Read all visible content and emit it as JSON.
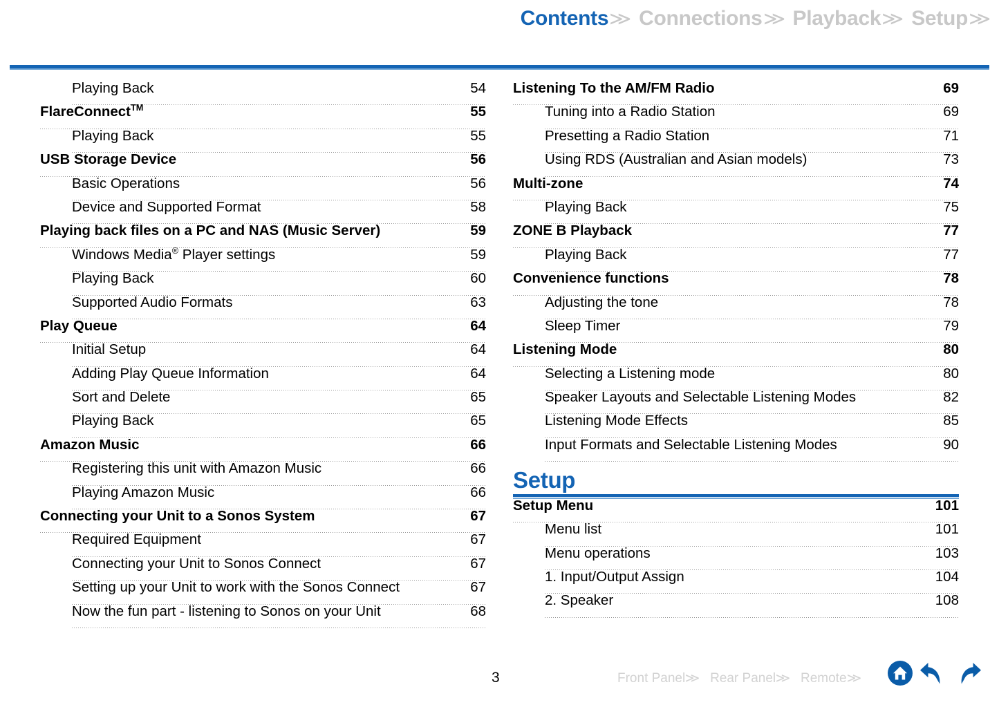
{
  "header": {
    "nav": [
      {
        "label": "Contents",
        "active": true,
        "chevron": "≫"
      },
      {
        "label": "Connections",
        "active": false,
        "chevron": "≫"
      },
      {
        "label": "Playback",
        "active": false,
        "chevron": "≫"
      },
      {
        "label": "Setup",
        "active": false,
        "chevron": "≫"
      }
    ],
    "accent_color": "#1464b4",
    "inactive_color": "#c8c8c8"
  },
  "left_column": {
    "rows": [
      {
        "level": 2,
        "title": "Playing Back",
        "page": "54"
      },
      {
        "level": 1,
        "title": "FlareConnect",
        "sup": "TM",
        "page": "55"
      },
      {
        "level": 2,
        "title": "Playing Back",
        "page": "55"
      },
      {
        "level": 1,
        "title": "USB Storage Device",
        "page": "56"
      },
      {
        "level": 2,
        "title": "Basic Operations",
        "page": "56"
      },
      {
        "level": 2,
        "title": "Device and Supported Format",
        "page": "58"
      },
      {
        "level": 1,
        "title": "Playing back files on a PC and NAS (Music Server)",
        "page": "59"
      },
      {
        "level": 2,
        "title": "Windows Media",
        "sup": "®",
        "title_after": " Player settings",
        "page": "59"
      },
      {
        "level": 2,
        "title": "Playing Back",
        "page": "60"
      },
      {
        "level": 2,
        "title": "Supported Audio Formats",
        "page": "63"
      },
      {
        "level": 1,
        "title": "Play Queue",
        "page": "64"
      },
      {
        "level": 2,
        "title": "Initial Setup",
        "page": "64"
      },
      {
        "level": 2,
        "title": "Adding Play Queue Information",
        "page": "64"
      },
      {
        "level": 2,
        "title": "Sort and Delete",
        "page": "65"
      },
      {
        "level": 2,
        "title": "Playing Back",
        "page": "65"
      },
      {
        "level": 1,
        "title": "Amazon Music",
        "page": "66"
      },
      {
        "level": 2,
        "title": "Registering this unit with Amazon Music",
        "page": "66"
      },
      {
        "level": 2,
        "title": "Playing Amazon Music",
        "page": "66"
      },
      {
        "level": 1,
        "title": "Connecting your Unit to a Sonos System",
        "page": "67"
      },
      {
        "level": 2,
        "title": "Required Equipment",
        "page": "67"
      },
      {
        "level": 2,
        "title": "Connecting your Unit to Sonos Connect",
        "page": "67"
      },
      {
        "level": 2,
        "title": "Setting up your Unit to work with the Sonos Connect",
        "page": "67"
      },
      {
        "level": 2,
        "title": "Now the fun part - listening to Sonos on your Unit",
        "page": "68"
      }
    ]
  },
  "right_column": {
    "rows_before_section": [
      {
        "level": 1,
        "title": "Listening To the AM/FM Radio",
        "page": "69"
      },
      {
        "level": 2,
        "title": "Tuning into a Radio Station",
        "page": "69"
      },
      {
        "level": 2,
        "title": "Presetting a Radio Station",
        "page": "71"
      },
      {
        "level": 2,
        "title": "Using RDS (Australian and Asian models)",
        "page": "73"
      },
      {
        "level": 1,
        "title": "Multi-zone",
        "page": "74"
      },
      {
        "level": 2,
        "title": "Playing Back",
        "page": "75"
      },
      {
        "level": 1,
        "title": "ZONE B Playback",
        "page": "77"
      },
      {
        "level": 2,
        "title": "Playing Back",
        "page": "77"
      },
      {
        "level": 1,
        "title": "Convenience functions",
        "page": "78"
      },
      {
        "level": 2,
        "title": "Adjusting the tone",
        "page": "78"
      },
      {
        "level": 2,
        "title": "Sleep Timer",
        "page": "79"
      },
      {
        "level": 1,
        "title": "Listening Mode",
        "page": "80"
      },
      {
        "level": 2,
        "title": "Selecting a Listening mode",
        "page": "80"
      },
      {
        "level": 2,
        "title": "Speaker Layouts and Selectable Listening Modes",
        "page": "82"
      },
      {
        "level": 2,
        "title": "Listening Mode Effects",
        "page": "85"
      },
      {
        "level": 2,
        "title": "Input Formats and Selectable Listening Modes",
        "page": "90"
      }
    ],
    "section_heading": "Setup",
    "rows_after_section": [
      {
        "level": 1,
        "title": "Setup Menu",
        "page": "101"
      },
      {
        "level": 2,
        "title": "Menu list",
        "page": "101"
      },
      {
        "level": 2,
        "title": "Menu operations",
        "page": "103"
      },
      {
        "level": 2,
        "title": "1. Input/Output Assign",
        "page": "104"
      },
      {
        "level": 2,
        "title": "2. Speaker",
        "page": "108"
      }
    ]
  },
  "footer": {
    "page_number": "3",
    "links": [
      {
        "label": "Front Panel",
        "chevron": "≫"
      },
      {
        "label": "Rear Panel",
        "chevron": "≫"
      },
      {
        "label": "Remote",
        "chevron": "≫"
      }
    ],
    "icons": [
      {
        "name": "home-icon"
      },
      {
        "name": "back-arrow-icon"
      },
      {
        "name": "forward-arrow-icon"
      }
    ],
    "link_color": "#d2d2d2",
    "icon_color": "#0a5ca8"
  }
}
